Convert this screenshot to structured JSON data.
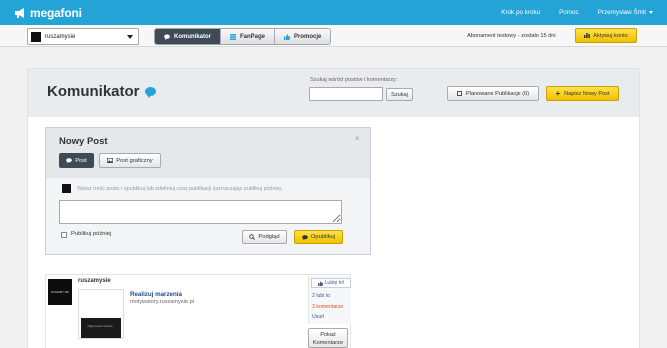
{
  "topbar": {
    "logo_text": "megafoni",
    "links": [
      "Krok po kroku",
      "Pomoc",
      "Przemysław Śmit"
    ]
  },
  "subbar": {
    "page_select": "ruszamysie",
    "tabs": [
      {
        "label": "Komunikator",
        "icon": "chat-icon",
        "active": true
      },
      {
        "label": "FanPage",
        "icon": "grid-icon",
        "active": false
      },
      {
        "label": "Promocje",
        "icon": "thumb-icon",
        "active": false
      }
    ],
    "trial_text": "Abonament testowy - zostało 15 dni",
    "activate_label": "Aktywuj konto"
  },
  "main": {
    "title": "Komunikator",
    "search_label": "Szukaj wśród postów i komentarzy:",
    "search_value": "",
    "search_button": "Szukaj",
    "planned_label": "Planowane Publikacje (0)",
    "new_post_label": "Napisz Nowy Post"
  },
  "new_post": {
    "title": "Nowy Post",
    "close": "×",
    "type_post": "Post",
    "type_graphic": "Post graficzny",
    "hint": "Wpisz treść postu i opublikuj lub zdefiniuj czas publikacji zaznaczając publikuj później.",
    "publish_later": "Publikuj później",
    "preview": "Podgląd",
    "publish": "Opublikuj"
  },
  "post": {
    "author": "ruszamysie",
    "avatar_text": "RUSZAMY SIĘ",
    "link_title": "Realizuj marzenia",
    "link_url": "motywatory.ruszamysie.pl",
    "image_caption": "Nigdy nie jest za późno...",
    "like_label": "Lubię to!",
    "likes": "2 lubi to",
    "comments": "3 komentarze",
    "delete": "Usuń",
    "show_comments": "Pokaż Komentarze"
  },
  "colors": {
    "brand": "#23a3d6",
    "accent_yellow": "#f5cc15",
    "dark_tab": "#3e4b57"
  }
}
